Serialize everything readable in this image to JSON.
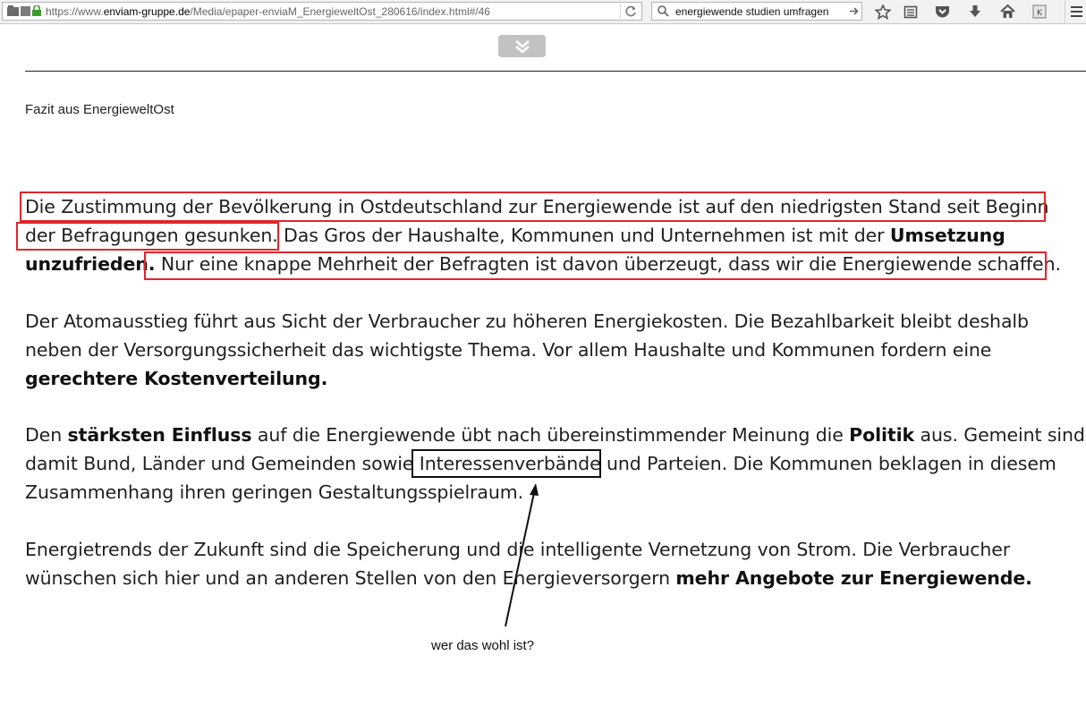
{
  "browser": {
    "url_prefix": "https://www.",
    "url_domain": "enviam-gruppe.de",
    "url_path": "/Media/epaper-enviaM_EnergieweltOst_280616/index.html#/46",
    "search_query": "energiewende studien umfragen"
  },
  "page": {
    "caption": "Fazit aus EnergieweltOst",
    "p1": {
      "l1": "Die Zustimmung der Bevölkerung in Ostdeutschland zur Energiewende ist auf den niedrigsten Stand seit Beginn",
      "l2a": "der Befragungen gesunken.",
      "l2b": " Das Gros der Haushalte, Kommunen und Unternehmen ist mit der ",
      "l2c": "Umsetzung",
      "l3a": "unzufrieden.",
      "l3b": " Nur eine knappe Mehrheit der Befragten ist davon überzeugt, dass wir die Energiewende schaffen."
    },
    "p2": {
      "l1": "Der Atomausstieg führt aus Sicht der Verbraucher zu höheren Energiekosten. Die Bezahlbarkeit bleibt deshalb",
      "l2": "neben der Versorgungssicherheit das wichtigste Thema. Vor allem Haushalte und Kommunen fordern eine",
      "l3": "gerechtere Kostenverteilung."
    },
    "p3": {
      "l1a": "Den ",
      "l1b": "stärksten Einfluss",
      "l1c": " auf die Energiewende übt nach übereinstimmender Meinung die ",
      "l1d": "Politik",
      "l1e": " aus. Gemeint sind",
      "l2a": "damit Bund, Länder und Gemeinden sowie ",
      "l2b": "Interessenverbände",
      "l2c": " und Parteien. Die Kommunen beklagen in diesem",
      "l3": "Zusammenhang ihren geringen Gestaltungsspielraum."
    },
    "p4": {
      "l1": "Energietrends der Zukunft sind die Speicherung und die intelligente Vernetzung von Strom. Die Verbraucher",
      "l2a": "wünschen sich hier und an anderen Stellen von den Energieversorgern ",
      "l2b": "mehr Angebote zur Energiewende."
    }
  },
  "annotation": {
    "note": "wer das wohl ist?",
    "highlight_color": "#e0252b",
    "marker_color": "#111111"
  },
  "icons": [
    "page-icon",
    "lock-icon",
    "reload-icon",
    "search-icon",
    "go-arrow-icon",
    "bookmark-star-icon",
    "reading-list-icon",
    "pocket-icon",
    "download-icon",
    "home-icon",
    "extension-icon",
    "menu-icon",
    "chevron-double-down-icon"
  ]
}
